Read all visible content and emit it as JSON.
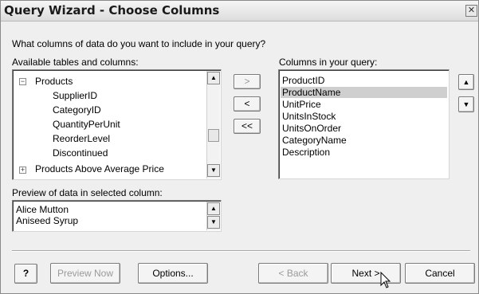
{
  "window": {
    "title": "Query Wizard - Choose Columns",
    "close_glyph": "✕"
  },
  "question": "What columns of data do you want to include in your query?",
  "available": {
    "label": "Available tables and columns:",
    "rows": [
      {
        "label": "Products",
        "expander": "−"
      },
      {
        "label": "SupplierID"
      },
      {
        "label": "CategoryID"
      },
      {
        "label": "QuantityPerUnit"
      },
      {
        "label": "ReorderLevel"
      },
      {
        "label": "Discontinued"
      },
      {
        "label": "Products Above Average Price",
        "expander": "+"
      }
    ]
  },
  "move_buttons": {
    "add": ">",
    "remove": "<",
    "remove_all": "<<"
  },
  "query_columns": {
    "label": "Columns in your query:",
    "items": [
      "ProductID",
      "ProductName",
      "UnitPrice",
      "UnitsInStock",
      "UnitsOnOrder",
      "CategoryName",
      "Description"
    ],
    "selected": "ProductName"
  },
  "order_buttons": {
    "up": "▲",
    "down": "▼"
  },
  "preview": {
    "label": "Preview of data in selected column:",
    "items": [
      "Alice Mutton",
      "Aniseed Syrup"
    ]
  },
  "footer": {
    "help": "?",
    "preview_now": "Preview Now",
    "options": "Options...",
    "back": "< Back",
    "next": "Next >",
    "cancel": "Cancel"
  },
  "icons": {
    "up_arrow": "▲",
    "down_arrow": "▼"
  }
}
